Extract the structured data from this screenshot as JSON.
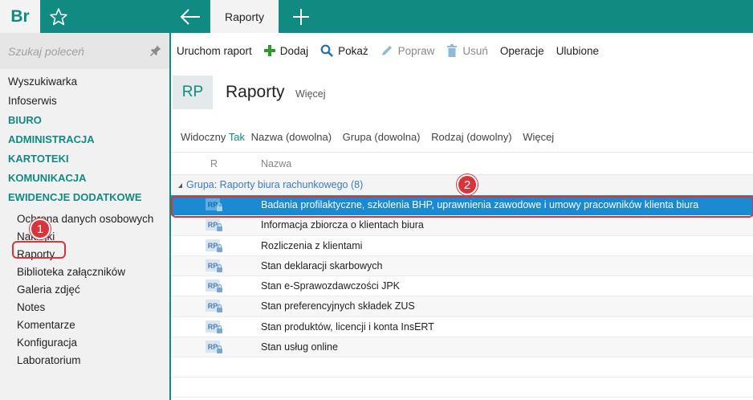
{
  "app": {
    "logo": "Br"
  },
  "tabs": [
    {
      "label": "Raporty"
    }
  ],
  "search": {
    "placeholder": "Szukaj poleceń"
  },
  "sidebar": {
    "items": [
      {
        "label": "Wyszukiwarka"
      },
      {
        "label": "Infoserwis"
      },
      {
        "label": "BIURO"
      },
      {
        "label": "ADMINISTRACJA"
      },
      {
        "label": "KARTOTEKI"
      },
      {
        "label": "KOMUNIKACJA"
      },
      {
        "label": "EWIDENCJE DODATKOWE"
      },
      {
        "label": "Ochrona danych osobowych"
      },
      {
        "label": "Naklejki"
      },
      {
        "label": "Raporty"
      },
      {
        "label": "Biblioteka załączników"
      },
      {
        "label": "Galeria zdjęć"
      },
      {
        "label": "Notes"
      },
      {
        "label": "Komentarze"
      },
      {
        "label": "Konfiguracja"
      },
      {
        "label": "Laboratorium"
      }
    ]
  },
  "toolbar": {
    "run": "Uruchom raport",
    "add": "Dodaj",
    "show": "Pokaż",
    "edit": "Popraw",
    "delete": "Usuń",
    "operations": "Operacje",
    "favorites": "Ulubione"
  },
  "header": {
    "badge": "RP",
    "title": "Raporty",
    "more": "Więcej"
  },
  "filters": {
    "visible_label": "Widoczny",
    "visible_value": "Tak",
    "name": "Nazwa (dowolna)",
    "group": "Grupa (dowolna)",
    "kind": "Rodzaj (dowolny)",
    "more": "Więcej"
  },
  "grid": {
    "columns": {
      "r": "R",
      "name": "Nazwa"
    },
    "group": "Grupa: Raporty biura rachunkowego (8)",
    "icon_text": "RP",
    "rows": [
      {
        "name": "Badania profilaktyczne, szkolenia BHP, uprawnienia zawodowe i umowy pracowników klienta biura"
      },
      {
        "name": "Informacja zbiorcza o klientach biura"
      },
      {
        "name": "Rozliczenia z klientami"
      },
      {
        "name": "Stan deklaracji skarbowych"
      },
      {
        "name": "Stan e-Sprawozdawczości JPK"
      },
      {
        "name": "Stan preferencyjnych składek ZUS"
      },
      {
        "name": "Stan produktów, licencji i konta InsERT"
      },
      {
        "name": "Stan usług online"
      }
    ]
  },
  "annotations": {
    "badge1": "1",
    "badge2": "2"
  },
  "colors": {
    "accent": "#118a82",
    "selection": "#1a8bd3",
    "annotation": "#d9343a"
  }
}
